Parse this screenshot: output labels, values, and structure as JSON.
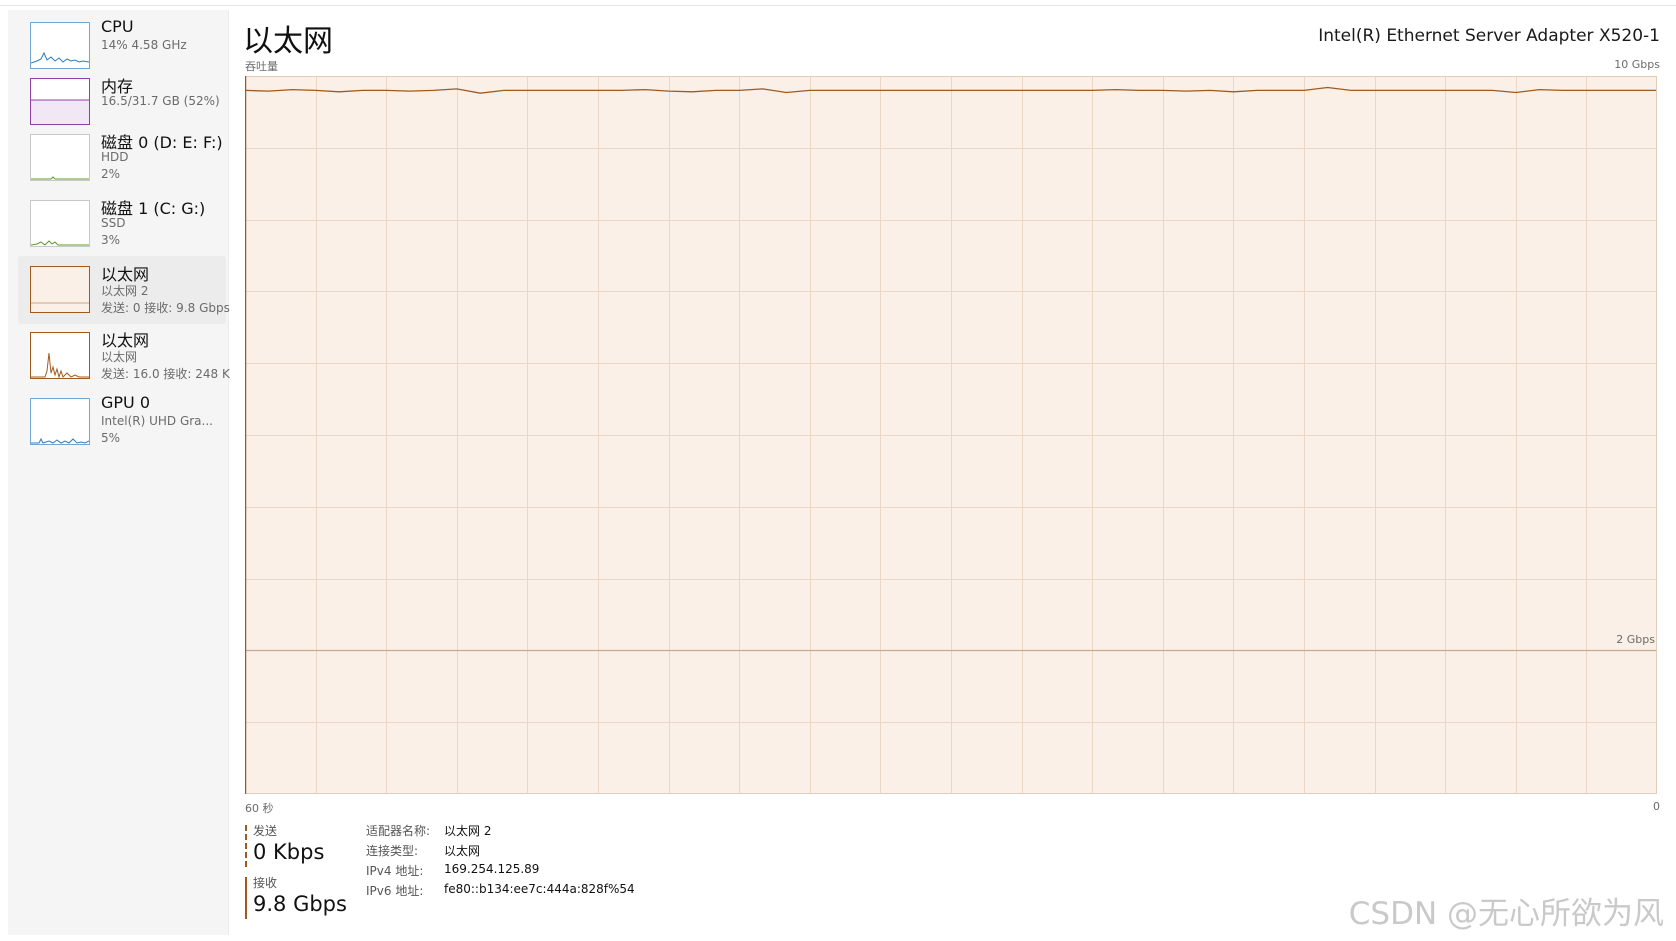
{
  "sidebar": {
    "items": [
      {
        "title": "CPU",
        "lines": [
          "14% 4.58 GHz"
        ]
      },
      {
        "title": "内存",
        "lines": [
          "16.5/31.7 GB (52%)"
        ]
      },
      {
        "title": "磁盘 0 (D: E: F:)",
        "lines": [
          "HDD",
          "2%"
        ]
      },
      {
        "title": "磁盘 1 (C: G:)",
        "lines": [
          "SSD",
          "3%"
        ]
      },
      {
        "title": "以太网",
        "lines": [
          "以太网 2",
          "发送: 0 接收: 9.8 Gbps"
        ],
        "selected": true
      },
      {
        "title": "以太网",
        "lines": [
          "以太网",
          "发送: 16.0 接收: 248 K"
        ]
      },
      {
        "title": "GPU 0",
        "lines": [
          "Intel(R) UHD Gra...",
          "5%"
        ]
      }
    ]
  },
  "header": {
    "title": "以太网",
    "adapter": "Intel(R) Ethernet Server Adapter X520-1"
  },
  "chart_labels": {
    "throughput": "吞吐量",
    "max": "10 Gbps",
    "mid": "2 Gbps",
    "left_time": "60 秒",
    "right_time": "0"
  },
  "chart_data": {
    "type": "area",
    "ylim": [
      0,
      10
    ],
    "unit": "Gbps",
    "xlim": [
      60,
      0
    ],
    "series": [
      {
        "name": "接收",
        "values": [
          9.8,
          9.79,
          9.81,
          9.8,
          9.78,
          9.8,
          9.8,
          9.79,
          9.8,
          9.82,
          9.76,
          9.8,
          9.8,
          9.8,
          9.8,
          9.8,
          9.8,
          9.81,
          9.79,
          9.78,
          9.8,
          9.8,
          9.82,
          9.77,
          9.8,
          9.8,
          9.8,
          9.8,
          9.8,
          9.8,
          9.8,
          9.8,
          9.8,
          9.8,
          9.8,
          9.8,
          9.8,
          9.81,
          9.8,
          9.8,
          9.79,
          9.8,
          9.78,
          9.8,
          9.8,
          9.8,
          9.84,
          9.8,
          9.8,
          9.8,
          9.8,
          9.8,
          9.8,
          9.8,
          9.77,
          9.81,
          9.8,
          9.8,
          9.8,
          9.8,
          9.8
        ],
        "color": "#a05a1e"
      },
      {
        "name": "发送",
        "values": [
          0,
          0,
          0,
          0,
          0,
          0,
          0,
          0,
          0,
          0,
          0,
          0,
          0,
          0,
          0,
          0,
          0,
          0,
          0,
          0,
          0,
          0,
          0,
          0,
          0,
          0,
          0,
          0,
          0,
          0,
          0,
          0,
          0,
          0,
          0,
          0,
          0,
          0,
          0,
          0,
          0,
          0,
          0,
          0,
          0,
          0,
          0,
          0,
          0,
          0,
          0,
          0,
          0,
          0,
          0,
          0,
          0,
          0,
          0,
          0,
          0
        ],
        "color": "#a05a1e"
      }
    ],
    "grid": true,
    "gridlines": {
      "vertical": 19,
      "horizontal": 9
    },
    "colors": {
      "line": "#a05a1e",
      "fill": "#faf0e7",
      "grid": "#ead7c4",
      "scale_line": "#c9a98a"
    }
  },
  "stats": {
    "send_label": "发送",
    "send_value": "0 Kbps",
    "recv_label": "接收",
    "recv_value": "9.8 Gbps"
  },
  "properties": [
    {
      "key": "适配器名称:",
      "value": "以太网 2"
    },
    {
      "key": "连接类型:",
      "value": "以太网"
    },
    {
      "key": "IPv4 地址:",
      "value": "169.254.125.89"
    },
    {
      "key": "IPv6 地址:",
      "value": "fe80::b134:ee7c:444a:828f%54"
    }
  ],
  "watermark": "CSDN @无心所欲为风"
}
